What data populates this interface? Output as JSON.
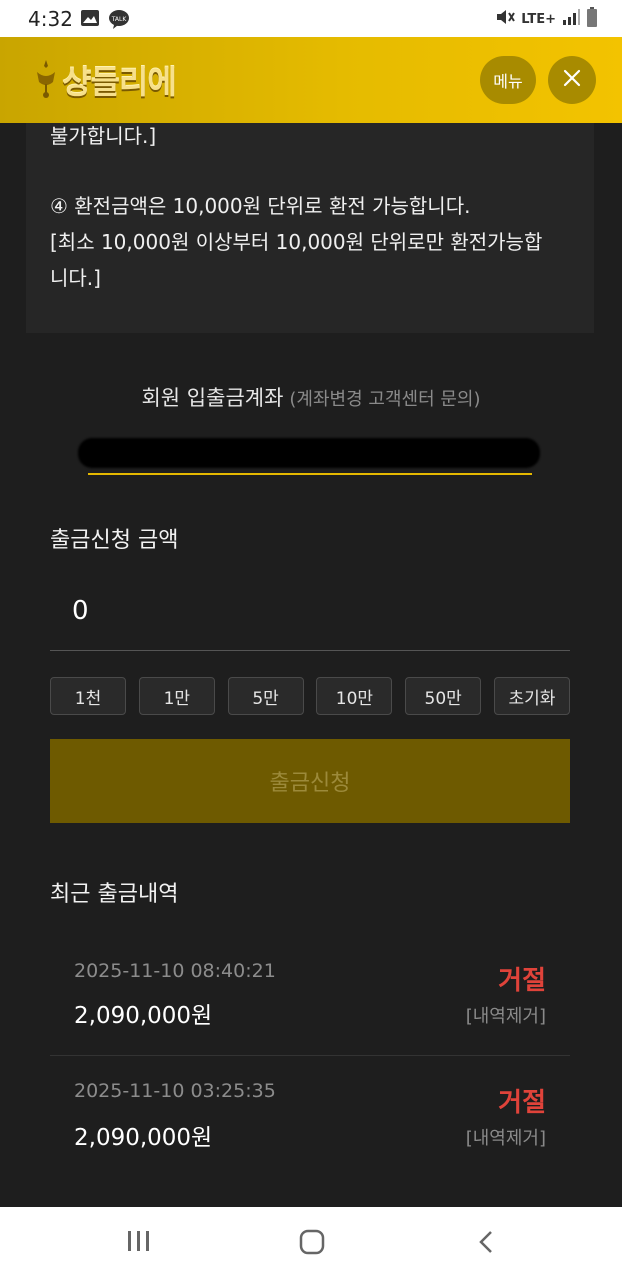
{
  "status_bar": {
    "time": "4:32",
    "network": "LTE+",
    "icons": [
      "image-icon",
      "talk-icon",
      "mute-icon",
      "signal-icon",
      "battery-icon"
    ]
  },
  "header": {
    "logo_text": "샹들리에",
    "menu_label": "메뉴",
    "accent_color": "#e5bb00"
  },
  "notice": {
    "line1": "불가합니다.]",
    "line2": "④ 환전금액은 10,000원 단위로 환전 가능합니다.",
    "line3": "[최소 10,000원 이상부터 10,000원 단위로만 환전가능합",
    "line4": "니다.]"
  },
  "account": {
    "label": "회원 입출금계좌",
    "sub_label": "(계좌변경 고객센터 문의)"
  },
  "withdraw": {
    "title": "출금신청 금액",
    "amount": "0",
    "chips": [
      "1천",
      "1만",
      "5만",
      "10만",
      "50만",
      "초기화"
    ],
    "submit_label": "출금신청"
  },
  "history": {
    "title": "최근 출금내역",
    "rows": [
      {
        "date": "2025-11-10 08:40:21",
        "amount": "2,090,000원",
        "status": "거절",
        "remove_label": "[내역제거]"
      },
      {
        "date": "2025-11-10 03:25:35",
        "amount": "2,090,000원",
        "status": "거절",
        "remove_label": "[내역제거]"
      }
    ],
    "status_color": "#e0433a"
  },
  "nav_bar": {
    "buttons": [
      "recent-apps-icon",
      "home-icon",
      "back-icon"
    ]
  }
}
